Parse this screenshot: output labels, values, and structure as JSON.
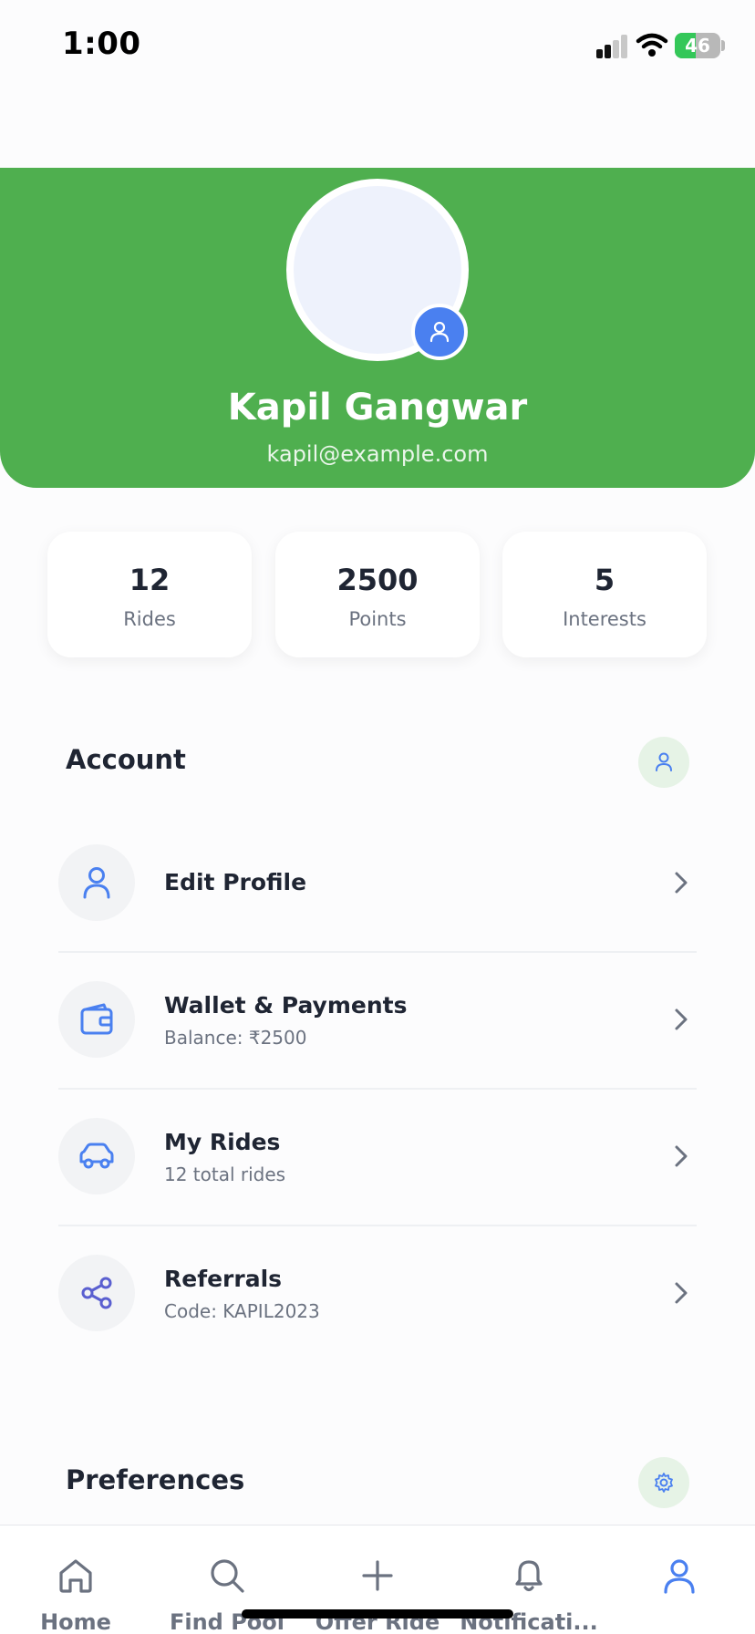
{
  "status_bar": {
    "time": "1:00",
    "battery": "46"
  },
  "profile": {
    "name": "Kapil Gangwar",
    "email": "kapil@example.com"
  },
  "stats": [
    {
      "value": "12",
      "label": "Rides"
    },
    {
      "value": "2500",
      "label": "Points"
    },
    {
      "value": "5",
      "label": "Interests"
    }
  ],
  "account": {
    "title": "Account",
    "items": [
      {
        "title": "Edit Profile",
        "subtitle": "",
        "icon": "user-icon"
      },
      {
        "title": "Wallet & Payments",
        "subtitle": "Balance: ₹2500",
        "icon": "wallet-icon"
      },
      {
        "title": "My Rides",
        "subtitle": "12 total rides",
        "icon": "car-icon"
      },
      {
        "title": "Referrals",
        "subtitle": "Code: KAPIL2023",
        "icon": "share-icon"
      }
    ]
  },
  "preferences": {
    "title": "Preferences"
  },
  "tabs": [
    {
      "label": "Home",
      "icon": "home-icon"
    },
    {
      "label": "Find Pool",
      "icon": "search-icon"
    },
    {
      "label": "Offer Ride",
      "icon": "plus-icon"
    },
    {
      "label": "Notificati...",
      "icon": "bell-icon"
    },
    {
      "label": "",
      "icon": "profile-icon",
      "active": true
    }
  ],
  "colors": {
    "header_green": "#4faf4f",
    "accent_blue": "#4a80f0",
    "muted_text": "#6b7280"
  }
}
